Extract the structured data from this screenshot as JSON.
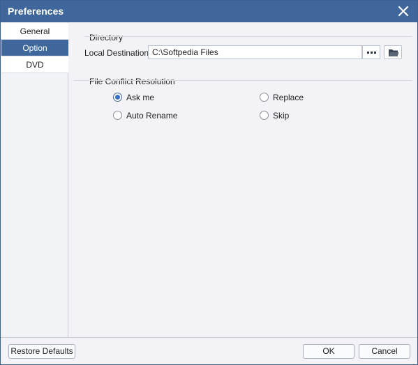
{
  "window": {
    "title": "Preferences"
  },
  "sidebar": {
    "items": [
      {
        "label": "General",
        "active": false
      },
      {
        "label": "Option",
        "active": true
      },
      {
        "label": "DVD",
        "active": false
      }
    ]
  },
  "directory": {
    "section_label": "Directory",
    "local_destination_label": "Local Destination:",
    "local_destination_value": "C:\\Softpedia Files"
  },
  "conflict": {
    "section_label": "File Conflict Resolution",
    "options": [
      {
        "label": "Ask me",
        "checked": true
      },
      {
        "label": "Replace",
        "checked": false
      },
      {
        "label": "Auto Rename",
        "checked": false
      },
      {
        "label": "Skip",
        "checked": false
      }
    ]
  },
  "footer": {
    "restore_label": "Restore Defaults",
    "ok_label": "OK",
    "cancel_label": "Cancel"
  },
  "colors": {
    "titlebar": "#3f679b",
    "accent": "#3a6fc4"
  }
}
